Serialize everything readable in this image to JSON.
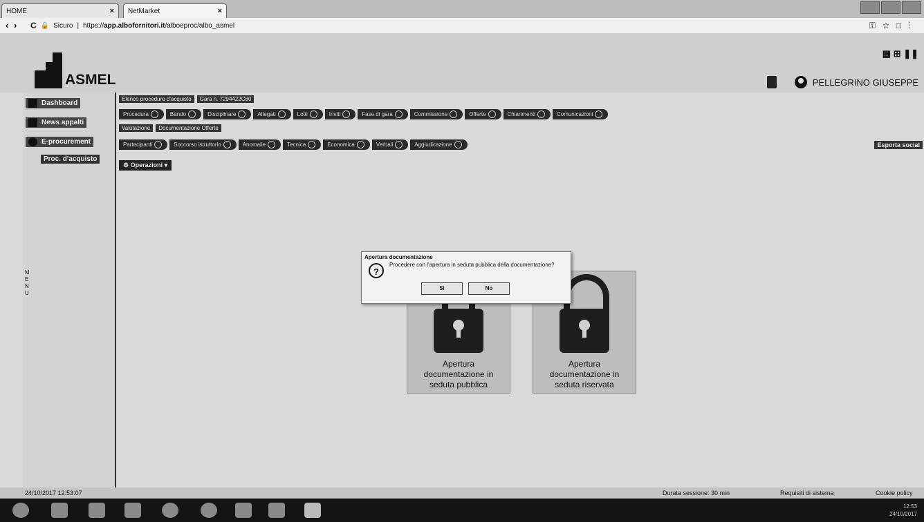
{
  "browser": {
    "tabs": [
      "HOME",
      "NetMarket"
    ],
    "secure_label": "Sicuro",
    "url_prefix": "https://",
    "url_host": "app.albofornitori.it",
    "url_path": "/alboeproc/albo_asmel"
  },
  "header": {
    "logo_text": "ASMEL",
    "user_name": "PELLEGRINO GIUSEPPE"
  },
  "sidebar": {
    "items": [
      {
        "label": "Dashboard",
        "icon": "home-icon"
      },
      {
        "label": "News appalti",
        "icon": "scales-icon"
      },
      {
        "label": "E-procurement",
        "icon": "globe-icon"
      }
    ],
    "subitem": "Proc. d'acquisto",
    "vertical_label": "MENU"
  },
  "content": {
    "breadcrumbs": [
      "Elenco procedure d'acquisto",
      "Gara n. 7294422C80"
    ],
    "steps_row1": [
      "Procedura",
      "Bando",
      "Disciplinare",
      "Allegati",
      "Lotti",
      "Inviti",
      "Fase di gara",
      "Commissione",
      "Offerte",
      "Chiarimenti",
      "Comunicazioni"
    ],
    "tabs": [
      "Valutazione",
      "Documentazione Offerte"
    ],
    "steps_row2": [
      "Partecipanti",
      "Soccorso istruttorio",
      "Anomalie",
      "Tecnica",
      "Economica",
      "Verbali",
      "Aggiudicazione"
    ],
    "operations_label": "Operazioni",
    "export_label": "Esporta social"
  },
  "cards": [
    {
      "label": "Apertura documentazione in seduta pubblica"
    },
    {
      "label": "Apertura documentazione in seduta riservata"
    }
  ],
  "dialog": {
    "title": "Apertura documentazione",
    "message": "Procedere con l'apertura in seduta pubblica della documentazione?",
    "yes_label": "Si",
    "no_label": "No"
  },
  "footer": {
    "timestamp": "24/10/2017 12:53:07",
    "session": "Durata sessione: 30 min",
    "requirements": "Requisiti di sistema",
    "cookie": "Cookie policy"
  },
  "taskbar": {
    "time": "12:53",
    "date": "24/10/2017"
  }
}
